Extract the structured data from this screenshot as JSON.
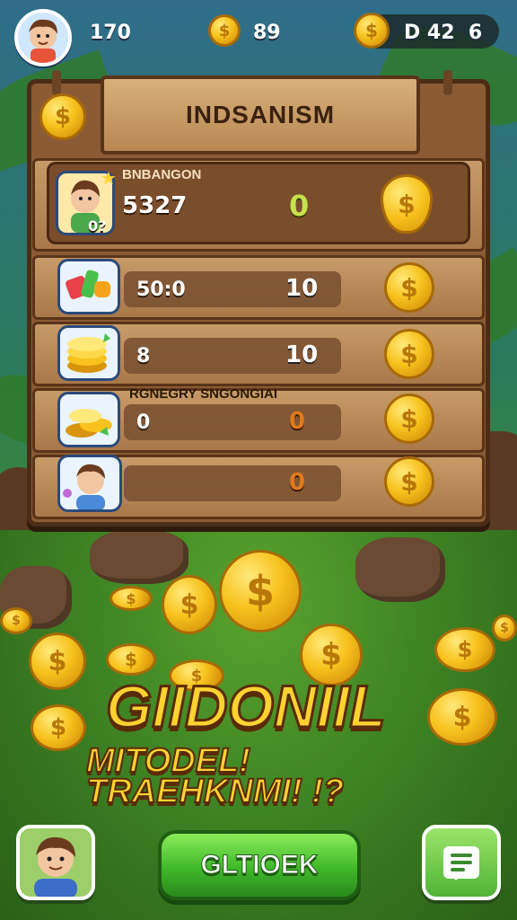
{
  "hud": {
    "level": "170",
    "coins": "89",
    "balance": "D 42  6"
  },
  "board": {
    "title": "INDSANISM"
  },
  "featured": {
    "label": "BNBANGON",
    "value": "5327",
    "mark": "0",
    "thumb_badge": "0?"
  },
  "rows": [
    {
      "value": "50:0",
      "mark": "10",
      "label": ""
    },
    {
      "value": "8",
      "mark": "10",
      "label": ""
    },
    {
      "value": "0",
      "mark": "0",
      "label": "RGNEGRY SNGONGIAI"
    },
    {
      "value": "",
      "mark": "0",
      "label": ""
    }
  ],
  "headline": {
    "line1": "GIIDONIIL",
    "line2": "MITODEL!",
    "line3": "TRAEHKNMI! !?"
  },
  "buttons": {
    "main": "GLTIOEK"
  },
  "colors": {
    "accent_gold": "#f7c21d",
    "wood": "#a9784a",
    "button_green": "#3fb82a"
  }
}
